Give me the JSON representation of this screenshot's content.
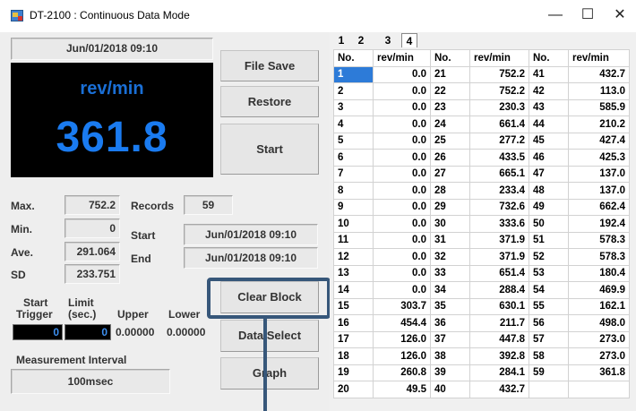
{
  "window": {
    "title": "DT-2100 : Continuous Data Mode",
    "minimize": "—",
    "maximize": "☐",
    "close": "✕"
  },
  "datetime_display": "Jun/01/2018 09:10",
  "display": {
    "unit": "rev/min",
    "value": "361.8",
    "color": "#1a7bf0"
  },
  "buttons": {
    "file_save": "File Save",
    "restore": "Restore",
    "start": "Start",
    "clear_block": "Clear Block",
    "data_select": "Data Select",
    "graph": "Graph"
  },
  "stats": {
    "max_label": "Max.",
    "max_value": "752.2",
    "min_label": "Min.",
    "min_value": "0",
    "ave_label": "Ave.",
    "ave_value": "291.064",
    "sd_label": "SD",
    "sd_value": "233.751",
    "records_label": "Records",
    "records_value": "59",
    "start_label": "Start",
    "start_value": "Jun/01/2018 09:10",
    "end_label": "End",
    "end_value": "Jun/01/2018 09:10"
  },
  "trigger": {
    "start_trigger_label_1": "Start",
    "start_trigger_label_2": "Trigger",
    "limit_label_1": "Limit",
    "limit_label_2": "(sec.)",
    "upper_label": "Upper",
    "lower_label": "Lower",
    "start_trigger_value": "0",
    "limit_value": "0",
    "upper_value": "0.00000",
    "lower_value": "0.00000"
  },
  "measurement": {
    "label": "Measurement Interval",
    "value": "100msec"
  },
  "tabs": [
    "1",
    "2",
    "3",
    "4"
  ],
  "active_tab": "4",
  "grid": {
    "headers": [
      "No.",
      "rev/min",
      "No.",
      "rev/min",
      "No.",
      "rev/min"
    ],
    "rows": [
      [
        "1",
        "0.0",
        "21",
        "752.2",
        "41",
        "432.7"
      ],
      [
        "2",
        "0.0",
        "22",
        "752.2",
        "42",
        "113.0"
      ],
      [
        "3",
        "0.0",
        "23",
        "230.3",
        "43",
        "585.9"
      ],
      [
        "4",
        "0.0",
        "24",
        "661.4",
        "44",
        "210.2"
      ],
      [
        "5",
        "0.0",
        "25",
        "277.2",
        "45",
        "427.4"
      ],
      [
        "6",
        "0.0",
        "26",
        "433.5",
        "46",
        "425.3"
      ],
      [
        "7",
        "0.0",
        "27",
        "665.1",
        "47",
        "137.0"
      ],
      [
        "8",
        "0.0",
        "28",
        "233.4",
        "48",
        "137.0"
      ],
      [
        "9",
        "0.0",
        "29",
        "732.6",
        "49",
        "662.4"
      ],
      [
        "10",
        "0.0",
        "30",
        "333.6",
        "50",
        "192.4"
      ],
      [
        "11",
        "0.0",
        "31",
        "371.9",
        "51",
        "578.3"
      ],
      [
        "12",
        "0.0",
        "32",
        "371.9",
        "52",
        "578.3"
      ],
      [
        "13",
        "0.0",
        "33",
        "651.4",
        "53",
        "180.4"
      ],
      [
        "14",
        "0.0",
        "34",
        "288.4",
        "54",
        "469.9"
      ],
      [
        "15",
        "303.7",
        "35",
        "630.1",
        "55",
        "162.1"
      ],
      [
        "16",
        "454.4",
        "36",
        "211.7",
        "56",
        "498.0"
      ],
      [
        "17",
        "126.0",
        "37",
        "447.8",
        "57",
        "273.0"
      ],
      [
        "18",
        "126.0",
        "38",
        "392.8",
        "58",
        "273.0"
      ],
      [
        "19",
        "260.8",
        "39",
        "284.1",
        "59",
        "361.8"
      ],
      [
        "20",
        "49.5",
        "40",
        "432.7",
        "",
        ""
      ]
    ]
  },
  "colors": {
    "selection": "#2d7bd8",
    "callout": "#37577a",
    "display_background": "#000000"
  }
}
